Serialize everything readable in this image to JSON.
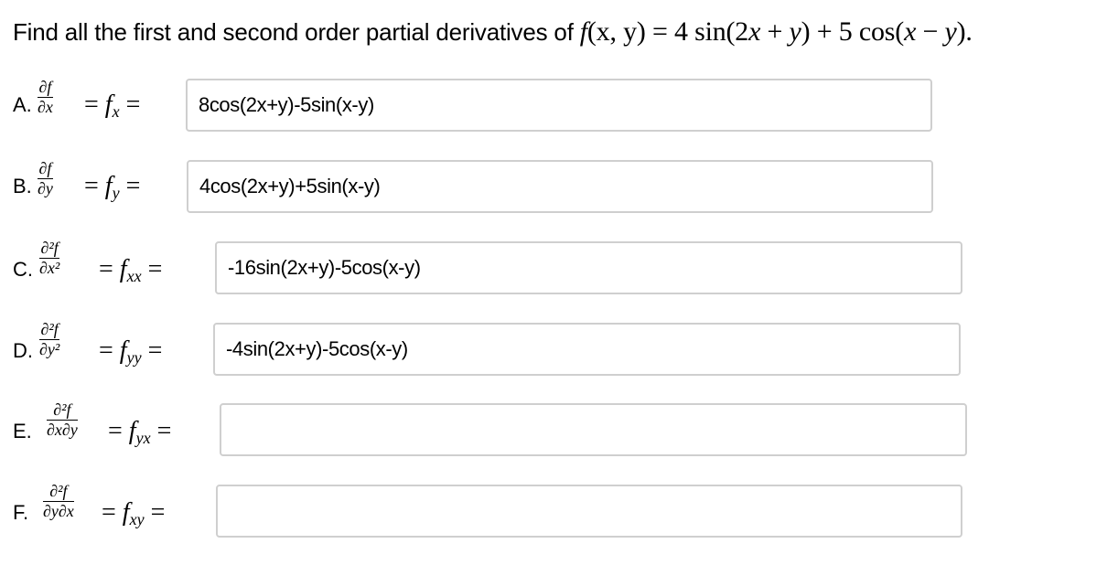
{
  "question": {
    "prefix": "Find all the first and second order partial derivatives of",
    "function_label": "f(x, y) = 4 sin(2x + y) + 5 cos(x − y).",
    "function_display": {
      "f": "f",
      "args": "(x, y) = 4 sin(2",
      "x1": "x",
      "mid": " + ",
      "y1": "y",
      "mid2": ") + 5 cos(",
      "x2": "x",
      "minus": " − ",
      "y2": "y",
      "end": ")."
    }
  },
  "parts": [
    {
      "letter": "A.",
      "num": "∂f",
      "den": "∂x",
      "sym": "f",
      "sub": "x",
      "value": "8cos(2x+y)-5sin(x-y)"
    },
    {
      "letter": "B.",
      "num": "∂f",
      "den": "∂y",
      "sym": "f",
      "sub": "y",
      "value": "4cos(2x+y)+5sin(x-y)"
    },
    {
      "letter": "C.",
      "num": "∂²f",
      "den": "∂x²",
      "sym": "f",
      "sub": "xx",
      "value": "-16sin(2x+y)-5cos(x-y)"
    },
    {
      "letter": "D.",
      "num": "∂²f",
      "den": "∂y²",
      "sym": "f",
      "sub": "yy",
      "value": "-4sin(2x+y)-5cos(x-y)"
    },
    {
      "letter": "E.",
      "num": "∂²f",
      "den": "∂x∂y",
      "sym": "f",
      "sub": "yx",
      "value": ""
    },
    {
      "letter": "F.",
      "num": "∂²f",
      "den": "∂y∂x",
      "sym": "f",
      "sub": "xy",
      "value": ""
    }
  ]
}
